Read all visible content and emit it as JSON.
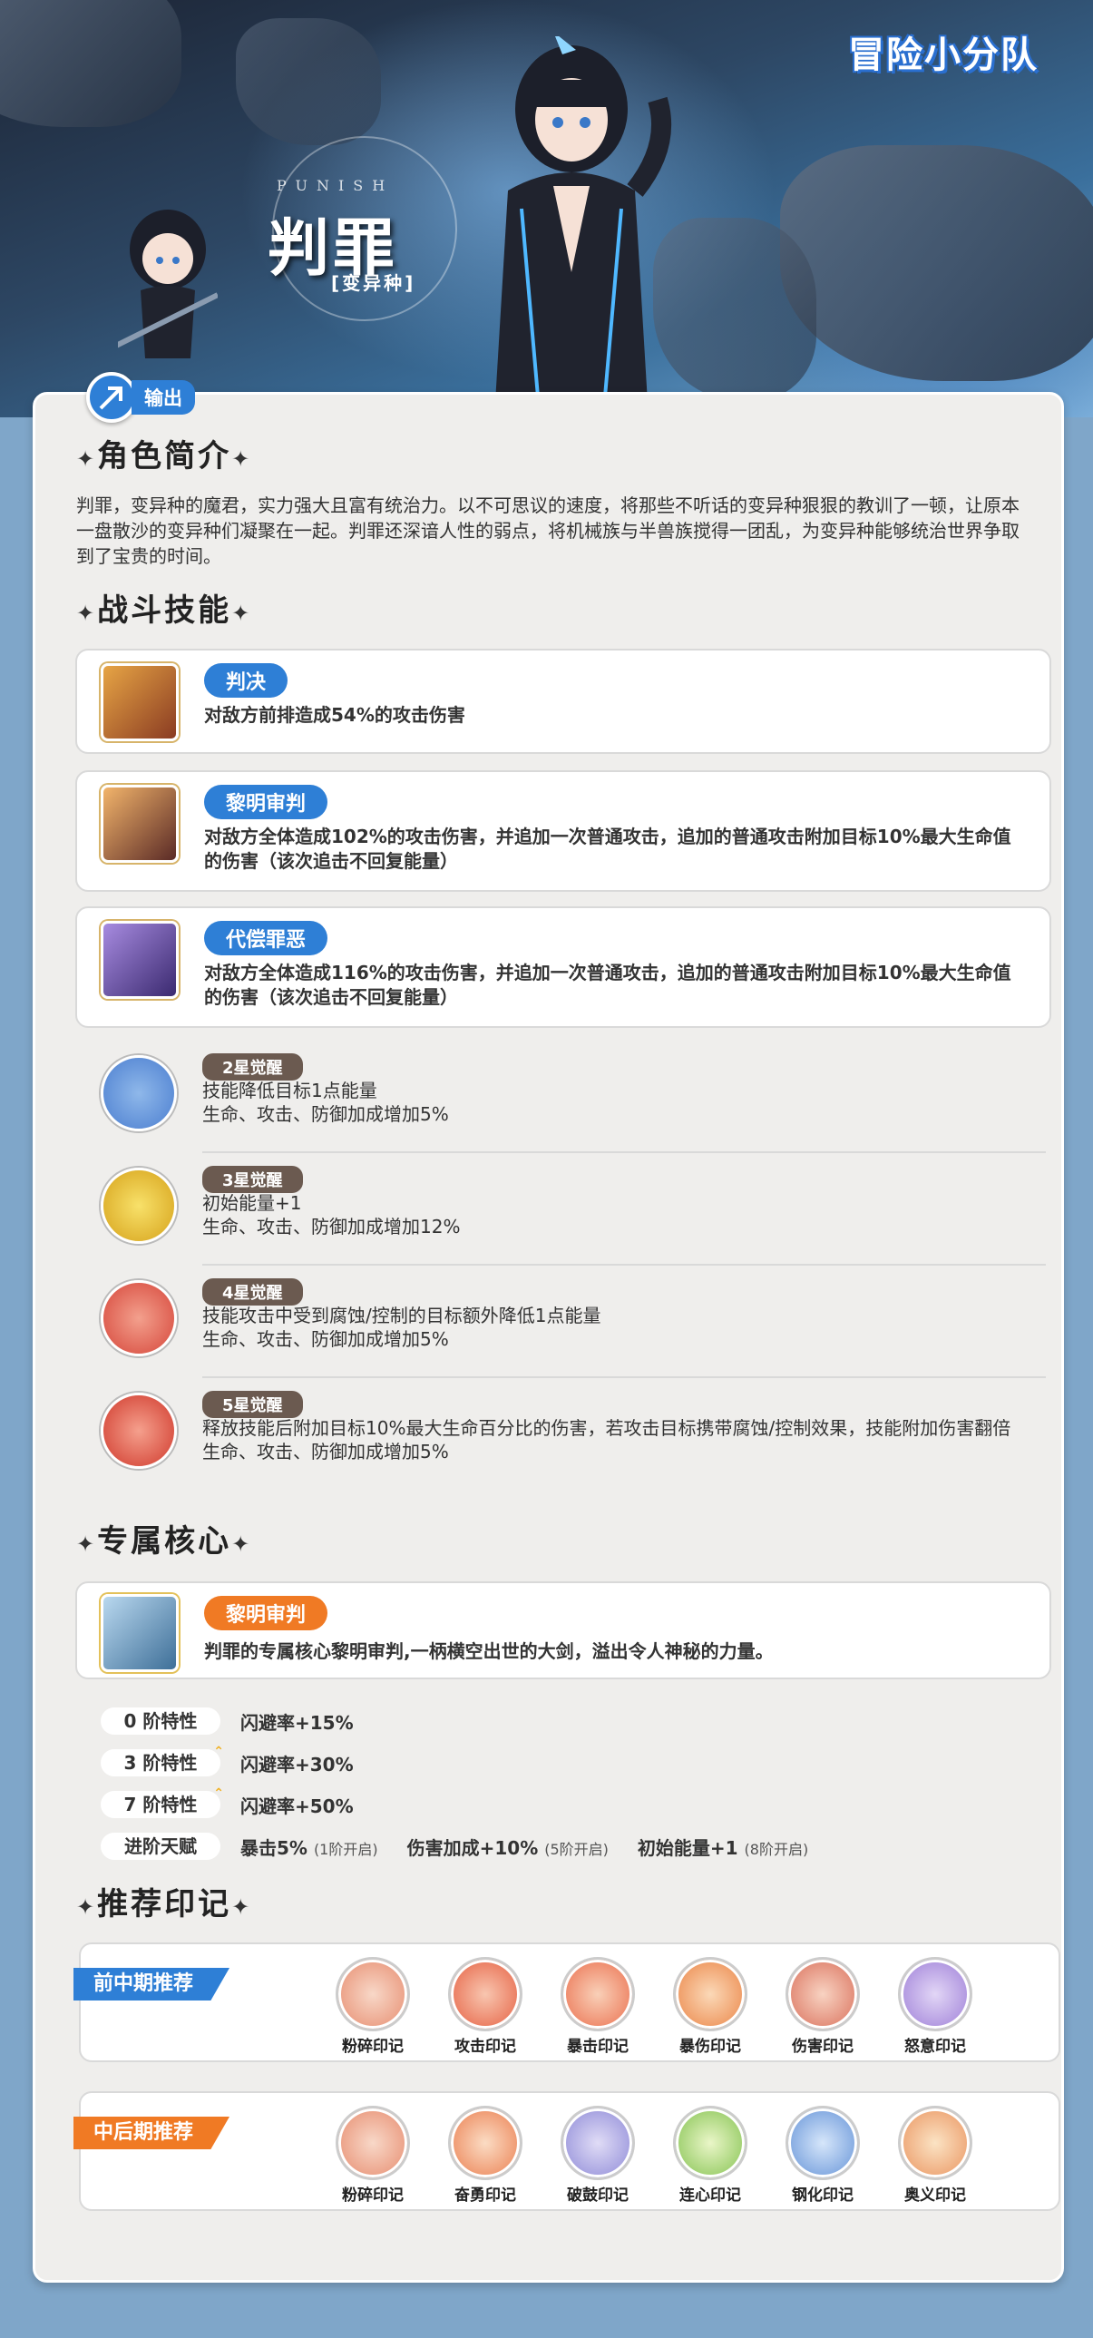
{
  "logo": "冒险小分队",
  "hero": {
    "name": "判罪",
    "en": "PUNISH",
    "faction": "[变异种]",
    "role": "输出"
  },
  "intro": {
    "title": "角色简介",
    "text": "判罪，变异种的魔君，实力强大且富有统治力。以不可思议的速度，将那些不听话的变异种狠狠的教训了一顿，让原本一盘散沙的变异种们凝聚在一起。判罪还深谙人性的弱点，将机械族与半兽族搅得一团乱，为变异种能够统治世界争取到了宝贵的时间。"
  },
  "skills": {
    "title": "战斗技能",
    "items": [
      {
        "name": "判决",
        "desc": "对敌方前排造成54%的攻击伤害"
      },
      {
        "name": "黎明审判",
        "desc": "对敌方全体造成102%的攻击伤害，并追加一次普通攻击，追加的普通攻击附加目标10%最大生命值的伤害（该次追击不回复能量）"
      },
      {
        "name": "代偿罪恶",
        "desc": "对敌方全体造成116%的攻击伤害，并追加一次普通攻击，追加的普通攻击附加目标10%最大生命值的伤害（该次追击不回复能量）"
      }
    ],
    "awakenings": [
      {
        "badge": "2星觉醒",
        "lines": [
          "技能降低目标1点能量",
          "生命、攻击、防御加成增加5%"
        ]
      },
      {
        "badge": "3星觉醒",
        "lines": [
          "初始能量+1",
          "生命、攻击、防御加成增加12%"
        ]
      },
      {
        "badge": "4星觉醒",
        "lines": [
          "技能攻击中受到腐蚀/控制的目标额外降低1点能量",
          "生命、攻击、防御加成增加5%"
        ]
      },
      {
        "badge": "5星觉醒",
        "lines": [
          "释放技能后附加目标10%最大生命百分比的伤害，若攻击目标携带腐蚀/控制效果，技能附加伤害翻倍",
          "生命、攻击、防御加成增加5%"
        ]
      }
    ]
  },
  "core": {
    "title": "专属核心",
    "name": "黎明审判",
    "desc": "判罪的专属核心黎明审判,一柄横空出世的大剑，溢出令人神秘的力量。",
    "traits": [
      {
        "label": "0 阶特性",
        "value": "闪避率+15%"
      },
      {
        "label": "3 阶特性",
        "value": "闪避率+30%"
      },
      {
        "label": "7 阶特性",
        "value": "闪避率+50%"
      }
    ],
    "talent": {
      "label": "进阶天赋",
      "items": [
        {
          "text": "暴击5%",
          "note": "(1阶开启)"
        },
        {
          "text": "伤害加成+10%",
          "note": "(5阶开启)"
        },
        {
          "text": "初始能量+1",
          "note": "(8阶开启)"
        }
      ]
    }
  },
  "marks": {
    "title": "推荐印记",
    "groups": [
      {
        "tag": "前中期推荐",
        "color": "#2e7fd6",
        "items": [
          "粉碎印记",
          "攻击印记",
          "暴击印记",
          "暴伤印记",
          "伤害印记",
          "怒意印记"
        ]
      },
      {
        "tag": "中后期推荐",
        "color": "#f07a24",
        "items": [
          "粉碎印记",
          "奋勇印记",
          "破鼓印记",
          "连心印记",
          "钢化印记",
          "奥义印记"
        ]
      }
    ]
  }
}
